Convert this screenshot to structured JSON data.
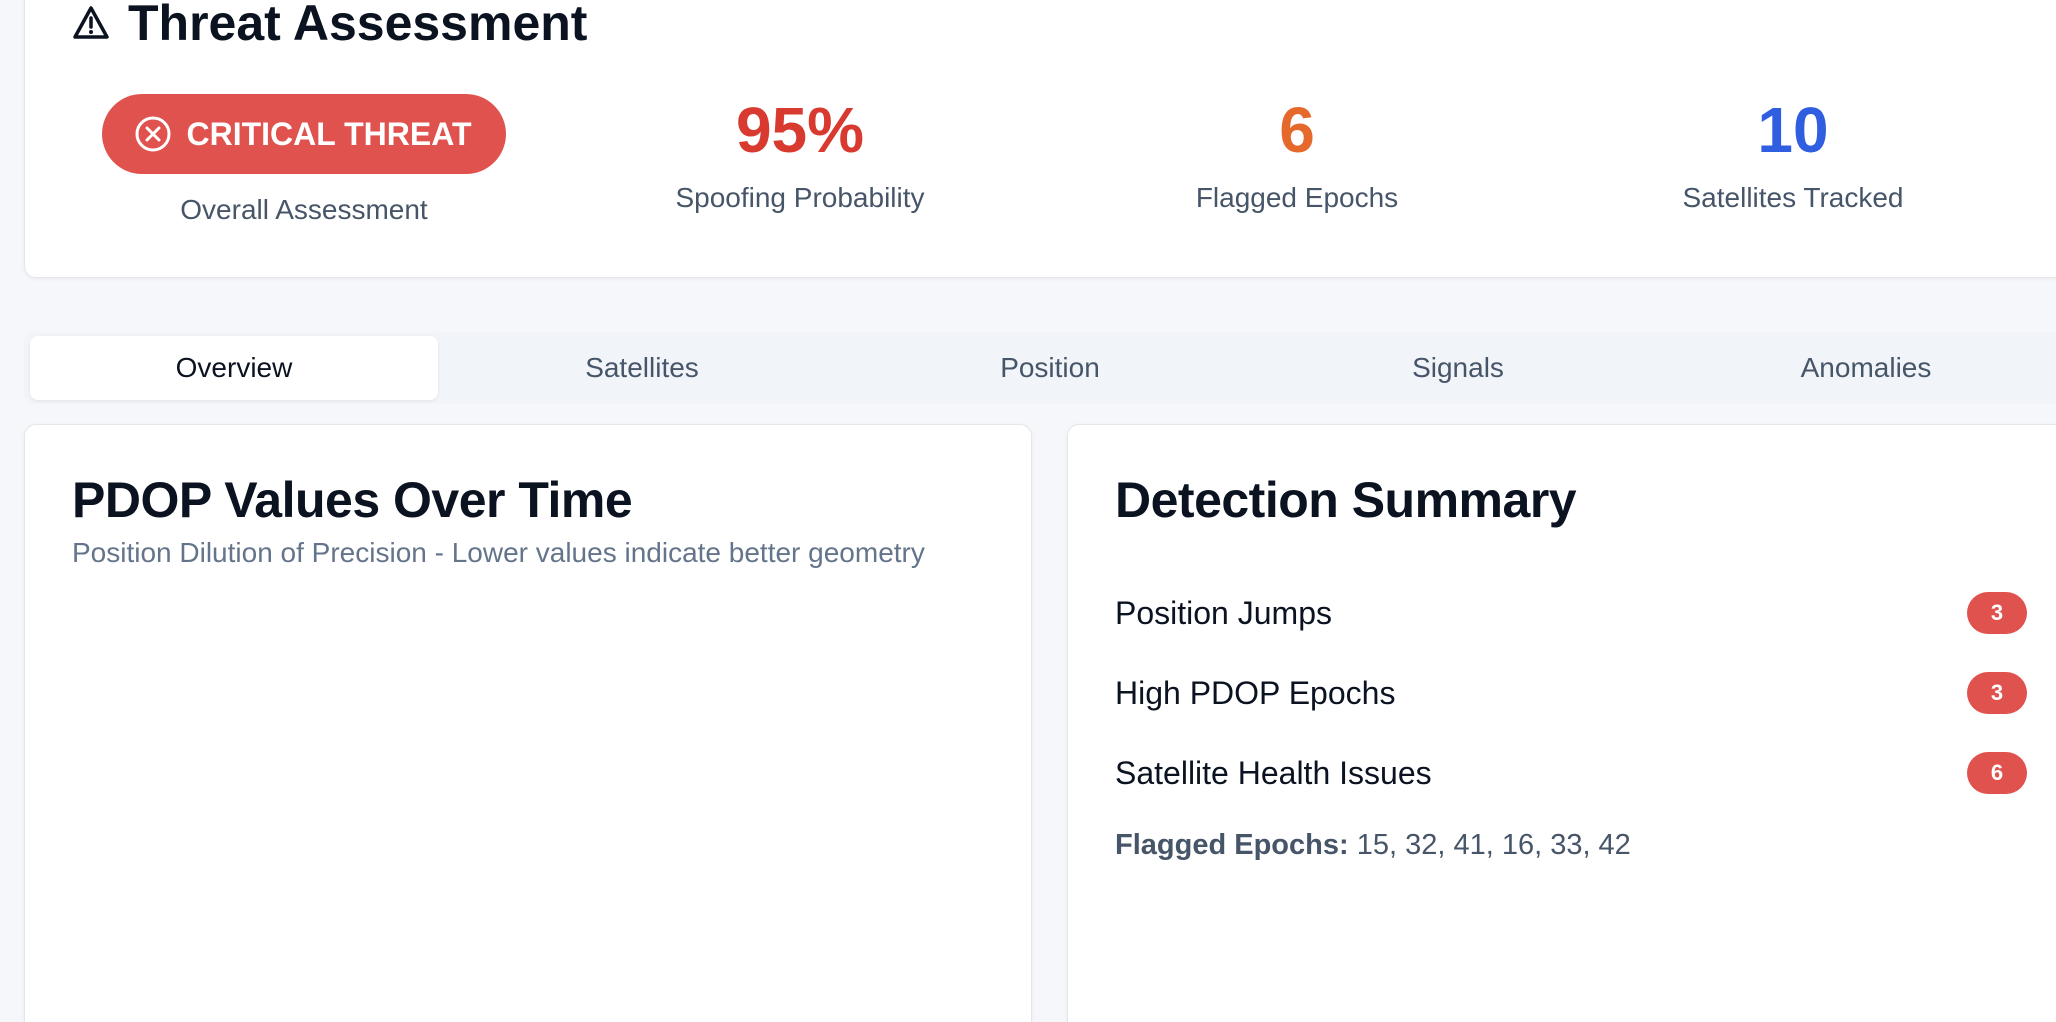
{
  "header": {
    "title": "Threat Assessment",
    "icon": "alert-triangle-icon"
  },
  "assessment": {
    "badge_label": "CRITICAL THREAT",
    "badge_icon": "x-circle-icon",
    "badge_color": "#e0524e",
    "label": "Overall Assessment"
  },
  "stats": {
    "spoofing": {
      "value": "95%",
      "label": "Spoofing Probability",
      "color": "#d83a2f"
    },
    "flagged": {
      "value": "6",
      "label": "Flagged Epochs",
      "color": "#e5692a"
    },
    "satellites": {
      "value": "10",
      "label": "Satellites Tracked",
      "color": "#2f5ee0"
    }
  },
  "tabs": [
    {
      "label": "Overview",
      "active": true
    },
    {
      "label": "Satellites",
      "active": false
    },
    {
      "label": "Position",
      "active": false
    },
    {
      "label": "Signals",
      "active": false
    },
    {
      "label": "Anomalies",
      "active": false
    }
  ],
  "pdop_panel": {
    "title": "PDOP Values Over Time",
    "subtitle": "Position Dilution of Precision - Lower values indicate better geometry"
  },
  "summary_panel": {
    "title": "Detection Summary",
    "rows": [
      {
        "label": "Position Jumps",
        "count": "3"
      },
      {
        "label": "High PDOP Epochs",
        "count": "3"
      },
      {
        "label": "Satellite Health Issues",
        "count": "6"
      }
    ],
    "flagged_label": "Flagged Epochs:",
    "flagged_values": "15, 32, 41, 16, 33, 42"
  }
}
